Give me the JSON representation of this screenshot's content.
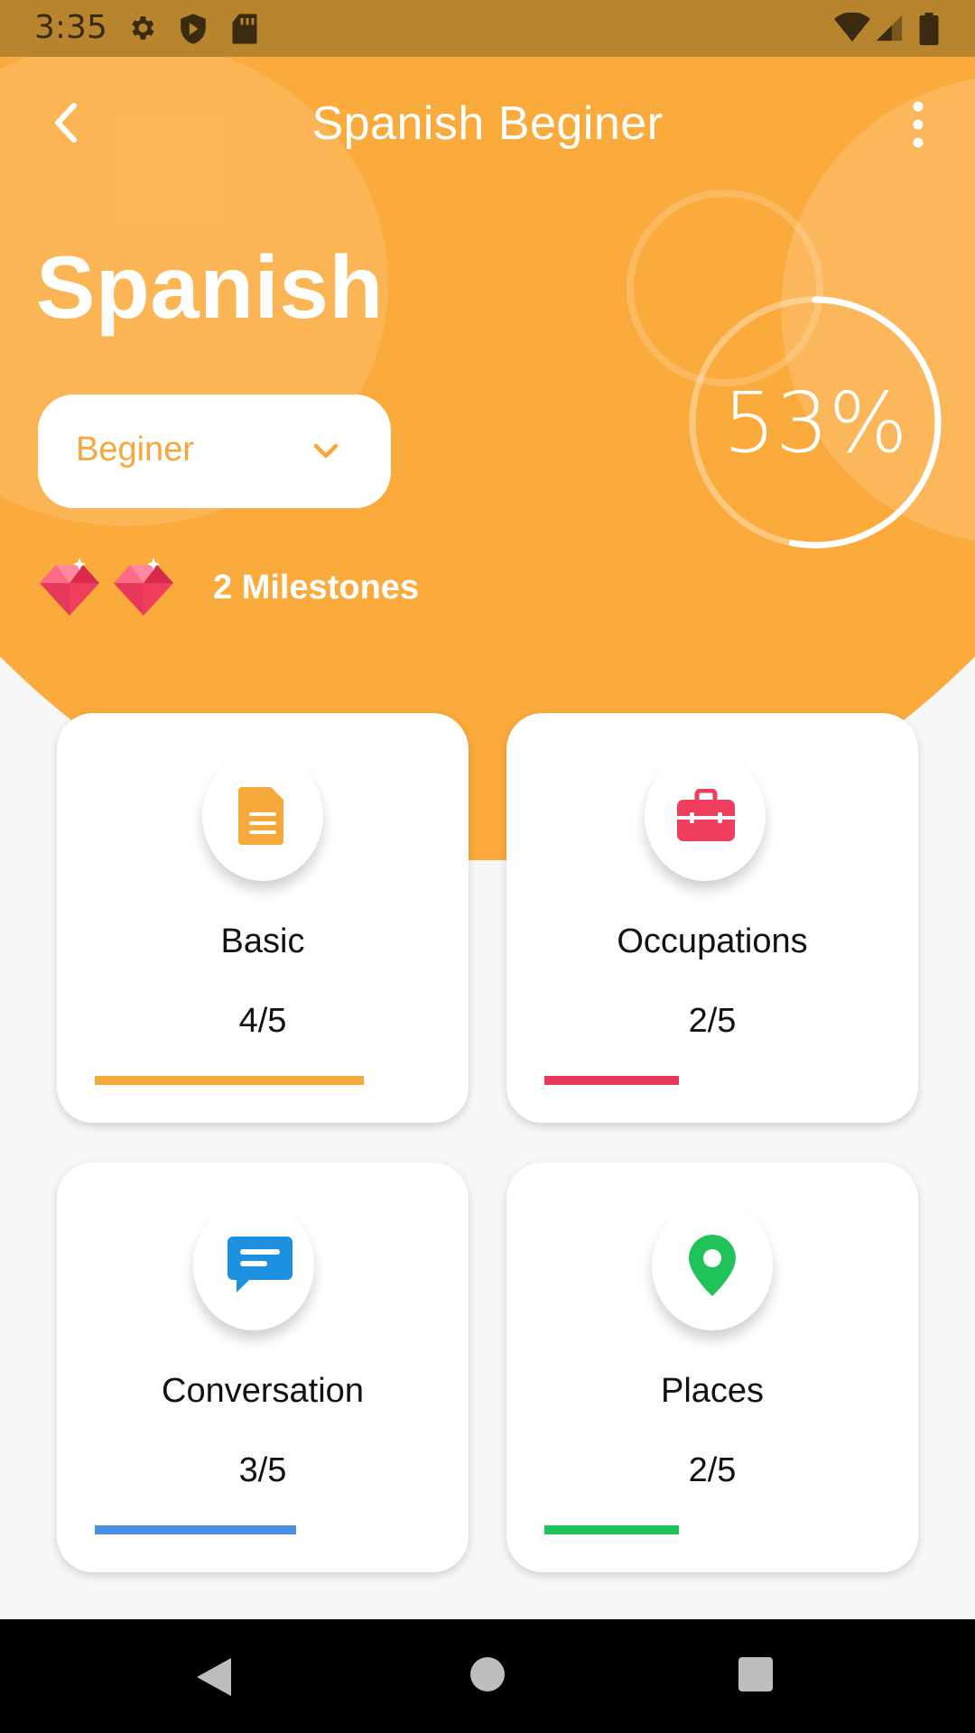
{
  "status_bar": {
    "time": "3:35"
  },
  "header": {
    "title": "Spanish Beginer",
    "language": "Spanish",
    "level_select": {
      "value": "Beginer"
    },
    "progress_percent": "53%",
    "progress_fraction": 0.53,
    "milestones_text": "2 Milestones",
    "milestone_count": 2
  },
  "cards": [
    {
      "title": "Basic",
      "count": "4/5",
      "progress": 0.8,
      "color": "#f6a83a",
      "icon": "document-icon"
    },
    {
      "title": "Occupations",
      "count": "2/5",
      "progress": 0.4,
      "color": "#e8395a",
      "icon": "briefcase-icon"
    },
    {
      "title": "Conversation",
      "count": "3/5",
      "progress": 0.6,
      "color": "#4a90e2",
      "icon": "chat-icon"
    },
    {
      "title": "Places",
      "count": "2/5",
      "progress": 0.4,
      "color": "#1fc35a",
      "icon": "location-pin-icon"
    }
  ],
  "colors": {
    "header": "#fbab3c",
    "status_bar": "#b9842e",
    "accent": "#f6a83a"
  }
}
